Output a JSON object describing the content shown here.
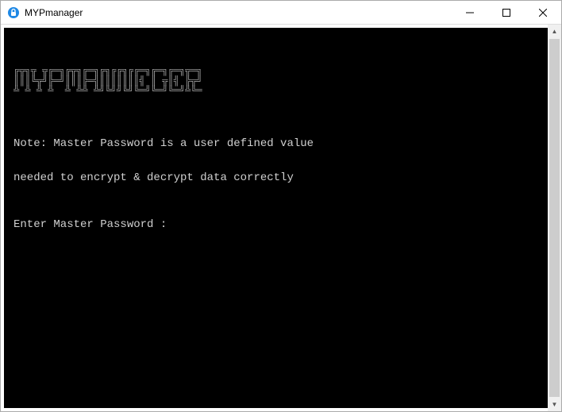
{
  "window": {
    "title": "MYPmanager"
  },
  "terminal": {
    "ascii_banner": "╔╦╗╦ ╦╔═╗╔╦╗╔═╗╔╗╔╔╗╔╔═╗╔═╗╔═╗╦═╗\n║║║╚╦╝╠═╝║║║╠═╣║║║║║║║╣ ║ ╦║╣ ╠╦╝\n╩ ╩ ╩ ╩  ╩ ╩╩ ╩╝╚╝╝╚╝╚═╝╚═╝╚═╝╩╚═",
    "note_line1": "Note: Master Password is a user defined value",
    "note_line2": "needed to encrypt & decrypt data correctly",
    "prompt": "Enter Master Password :"
  }
}
